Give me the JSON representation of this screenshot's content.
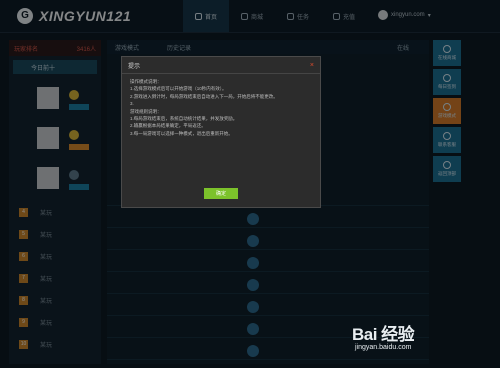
{
  "header": {
    "logo_letter": "G",
    "logo_text": "XINGYUN121",
    "nav": [
      {
        "label": "首页",
        "active": true
      },
      {
        "label": "商城",
        "active": false
      },
      {
        "label": "任务",
        "active": false
      },
      {
        "label": "充值",
        "active": false
      }
    ],
    "user_name": "xingyun.com"
  },
  "sidebar": {
    "title": "玩家排名",
    "value": "3416人",
    "subtitle": "今日前十",
    "ranks": [
      "4",
      "5",
      "6",
      "7",
      "8",
      "9",
      "10"
    ],
    "rank_label": "某玩"
  },
  "main": {
    "tabs": [
      "游戏模式",
      "历史记录"
    ],
    "right_label": "在线"
  },
  "right_rail": [
    {
      "label": "在线商城",
      "color": "#1d6f93"
    },
    {
      "label": "每日签到",
      "color": "#1d6f93"
    },
    {
      "label": "游戏模式",
      "color": "#d47a2a"
    },
    {
      "label": "联系客服",
      "color": "#1d6f93"
    },
    {
      "label": "返回顶部",
      "color": "#1d6f93"
    }
  ],
  "modal": {
    "title": "提示",
    "close": "×",
    "lines": [
      "操作模式说明：",
      "1.选择游戏模式后可以开始游戏（10秒内有效）。",
      "2.游戏进入倒计时，每局游戏结束后自动进入下一局，开始后将不能更改。",
      "3.",
      "游戏规则说明：",
      "1.每局游戏结束后，系统自动统计结果，并发放奖励。",
      "2.输赢根据本局结果确定，平局返还。",
      "3.每一局游戏可以选择一种模式，退出后重新开始。"
    ],
    "ok": "确定"
  },
  "watermark": {
    "brand": "Bai 经验",
    "url": "jingyan.baidu.com"
  }
}
